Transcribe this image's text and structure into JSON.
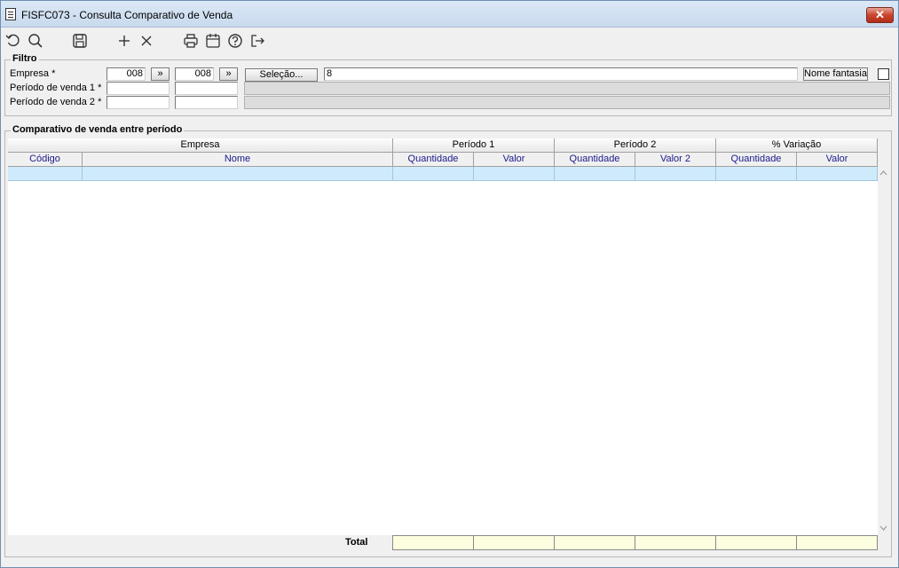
{
  "window": {
    "title": "FISFC073 - Consulta Comparativo de Venda",
    "close_symbol": "✕"
  },
  "toolbar": {
    "buttons": [
      {
        "icon": "undo-icon"
      },
      {
        "icon": "search-icon"
      },
      {
        "icon": "save-icon"
      },
      {
        "icon": "plus-icon"
      },
      {
        "icon": "close-icon"
      },
      {
        "icon": "print-icon"
      },
      {
        "icon": "calendar-icon"
      },
      {
        "icon": "help-icon"
      },
      {
        "icon": "exit-icon"
      }
    ]
  },
  "filtro": {
    "legend": "Filtro",
    "empresa_label": "Empresa *",
    "empresa_from": "008",
    "empresa_to": "008",
    "more_symbol": "»",
    "selecao_label": "Seleção...",
    "selecao_value": "8",
    "nome_fantasia_label": "Nome fantasia",
    "nome_fantasia_checked": false,
    "periodo1_label": "Período de venda 1 *",
    "periodo1_from": "",
    "periodo1_to": "",
    "periodo2_label": "Período de venda 2 *",
    "periodo2_from": "",
    "periodo2_to": ""
  },
  "comparativo": {
    "legend": "Comparativo de venda entre período",
    "group_headers": [
      "Empresa",
      "Período 1",
      "Período 2",
      "% Variação"
    ],
    "columns": [
      "Código",
      "Nome",
      "Quantidade",
      "Valor",
      "Quantidade",
      "Valor 2",
      "Quantidade",
      "Valor"
    ],
    "total_label": "Total"
  }
}
